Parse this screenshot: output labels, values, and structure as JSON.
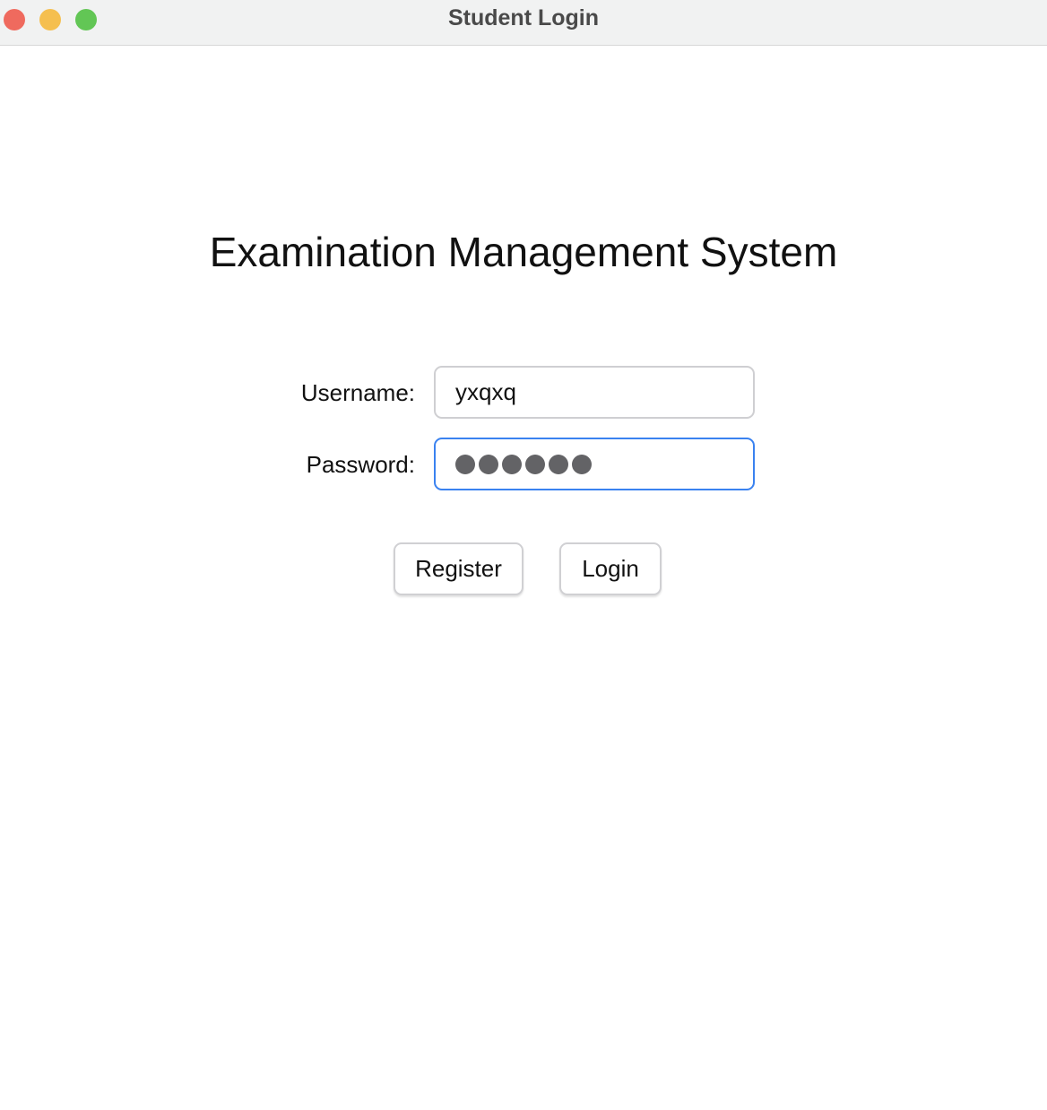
{
  "window": {
    "title": "Student Login",
    "colors": {
      "close": "#ef6a5e",
      "minimize": "#f5bf4f",
      "maximize": "#62c655",
      "focus": "#3a82f0"
    }
  },
  "main": {
    "heading": "Examination Management System",
    "username": {
      "label": "Username:",
      "value": "yxqxq"
    },
    "password": {
      "label": "Password:",
      "masked_length": 6
    },
    "buttons": {
      "register": "Register",
      "login": "Login"
    }
  }
}
